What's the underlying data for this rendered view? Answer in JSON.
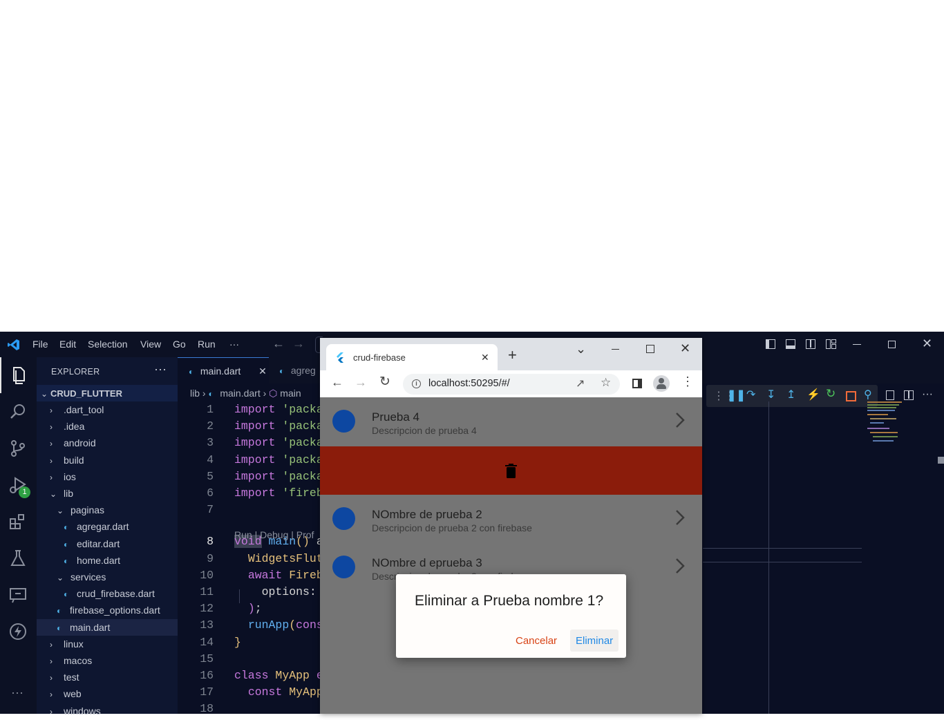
{
  "vscode": {
    "menu": [
      "File",
      "Edit",
      "Selection",
      "View",
      "Go",
      "Run",
      "···"
    ],
    "run_badge": "1",
    "sidebar": {
      "title": "EXPLORER",
      "more": "···",
      "root": "CRUD_FLUTTER",
      "items": [
        {
          "label": ".dart_tool",
          "type": "folder",
          "open": false
        },
        {
          "label": ".idea",
          "type": "folder",
          "open": false
        },
        {
          "label": "android",
          "type": "folder",
          "open": false
        },
        {
          "label": "build",
          "type": "folder",
          "open": false
        },
        {
          "label": "ios",
          "type": "folder",
          "open": false
        },
        {
          "label": "lib",
          "type": "folder",
          "open": true
        },
        {
          "label": "paginas",
          "type": "folder",
          "open": true
        },
        {
          "label": "agregar.dart",
          "type": "file"
        },
        {
          "label": "editar.dart",
          "type": "file"
        },
        {
          "label": "home.dart",
          "type": "file"
        },
        {
          "label": "services",
          "type": "folder",
          "open": true
        },
        {
          "label": "crud_firebase.dart",
          "type": "file"
        },
        {
          "label": "firebase_options.dart",
          "type": "file"
        },
        {
          "label": "main.dart",
          "type": "file",
          "selected": true
        },
        {
          "label": "linux",
          "type": "folder",
          "open": false
        },
        {
          "label": "macos",
          "type": "folder",
          "open": false
        },
        {
          "label": "test",
          "type": "folder",
          "open": false
        },
        {
          "label": "web",
          "type": "folder",
          "open": false
        },
        {
          "label": "windows",
          "type": "folder",
          "open": false
        }
      ]
    },
    "tabs": [
      {
        "label": "main.dart",
        "active": true,
        "close": "✕"
      },
      {
        "label": "agreg",
        "active": false
      }
    ],
    "breadcrumb": {
      "part1": "lib",
      "part2": "main.dart",
      "part3": "main"
    },
    "codelens": "Run | Debug | Prof",
    "code_lines": [
      {
        "n": "1",
        "text": "import 'packa"
      },
      {
        "n": "2",
        "text": "import 'packa"
      },
      {
        "n": "3",
        "text": "import 'packa"
      },
      {
        "n": "4",
        "text": "import 'packa"
      },
      {
        "n": "5",
        "text": "import 'packa"
      },
      {
        "n": "6",
        "text": "import 'fireb"
      },
      {
        "n": "7",
        "text": ""
      },
      {
        "n": "8",
        "text": "void main() a"
      },
      {
        "n": "9",
        "text": "  WidgetsFlut"
      },
      {
        "n": "10",
        "text": "  await Fireb"
      },
      {
        "n": "11",
        "text": "    options:"
      },
      {
        "n": "12",
        "text": "  );"
      },
      {
        "n": "13",
        "text": "  runApp(cons"
      },
      {
        "n": "14",
        "text": "}"
      },
      {
        "n": "15",
        "text": ""
      },
      {
        "n": "16",
        "text": "class MyApp e"
      },
      {
        "n": "17",
        "text": "  const MyApp"
      },
      {
        "n": "18",
        "text": ""
      }
    ]
  },
  "browser": {
    "tab_title": "crud-firebase",
    "tab_close": "✕",
    "new_tab": "+",
    "url": "localhost:50295/#/",
    "items": [
      {
        "title": "Prueba 4",
        "subtitle": "Descripcion de prueba 4"
      },
      {
        "title": "NOmbre de prueba 2",
        "subtitle": "Descripcion de prueba 2 con firebase"
      },
      {
        "title": "NOmbre d eprueba 3",
        "subtitle": "Descripcion de prueba 3 con firebase"
      }
    ],
    "dialog": {
      "question": "Eliminar a Prueba nombre 1?",
      "cancel": "Cancelar",
      "confirm": "Eliminar"
    }
  },
  "colors": {
    "delete_bg": "#8b1c0b",
    "avatar": "#0d47a1",
    "cancel": "#d84315",
    "confirm": "#1e88e5"
  }
}
